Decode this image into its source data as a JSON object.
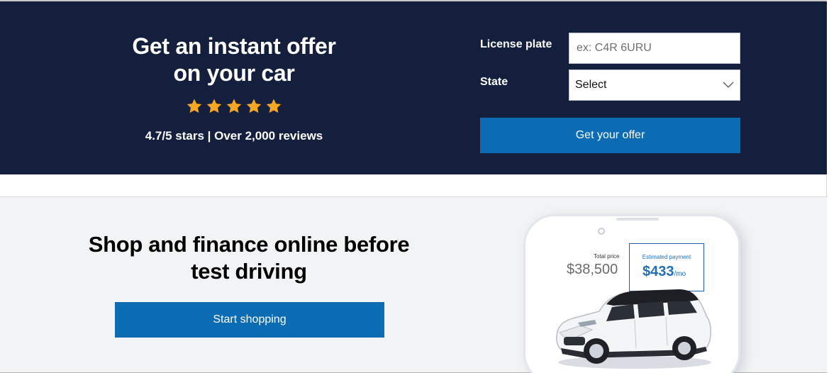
{
  "hero": {
    "title_line1": "Get an instant offer",
    "title_line2": "on your car",
    "rating_text": "4.7/5 stars | Over 2,000 reviews",
    "stars_count": 5,
    "star_color": "#f5a623",
    "background": "#131f3d"
  },
  "form": {
    "plate_label": "License plate",
    "plate_placeholder": "ex: C4R 6URU",
    "plate_value": "",
    "state_label": "State",
    "state_selected": "Select",
    "submit_label": "Get your offer",
    "accent": "#0b6cb4"
  },
  "shop": {
    "title_line1": "Shop and finance online before",
    "title_line2": "test driving",
    "button_label": "Start shopping"
  },
  "phone": {
    "total_label": "Total price",
    "total_value": "$38,500",
    "estimate_label": "Estimated payment",
    "estimate_value": "$433",
    "estimate_unit": "/mo"
  }
}
